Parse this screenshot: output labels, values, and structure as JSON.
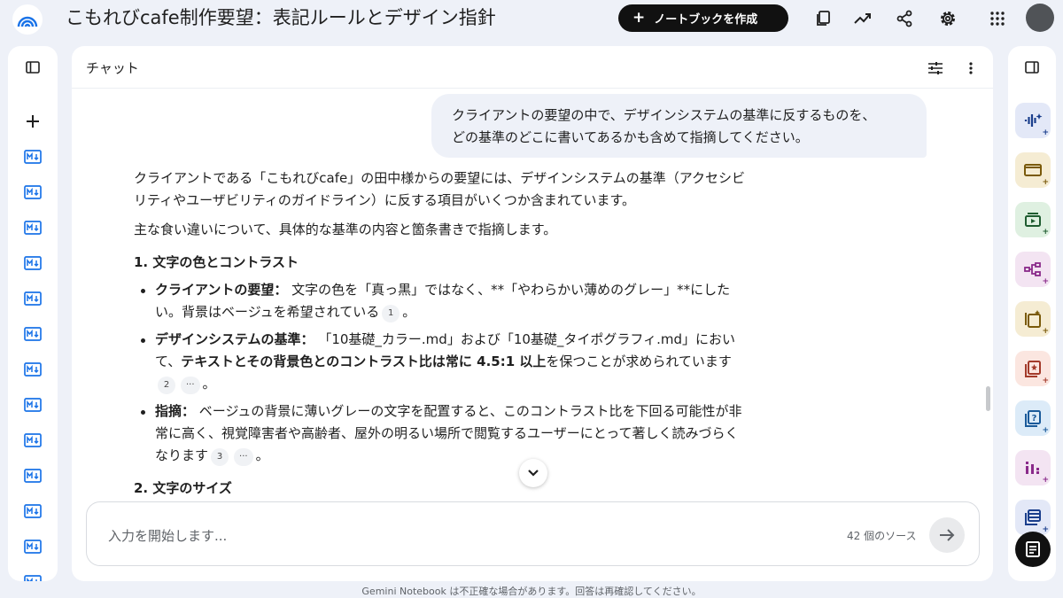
{
  "header": {
    "title": "こもれびcafe制作要望：表記ルールとデザイン指針",
    "create_label": "ノートブックを作成",
    "create_icon": "plus-icon",
    "icons": [
      "layers-icon",
      "trending-up-icon",
      "share-icon",
      "gear-icon",
      "apps-grid-icon"
    ]
  },
  "chat": {
    "title": "チャット",
    "user_message": {
      "line1": "クライアントの要望の中で、デザインシステムの基準に反するものを、",
      "line2": "どの基準のどこに書いてあるかも含めて指摘してください。"
    },
    "answer": {
      "intro1": "クライアントである「こもれびcafe」の田中様からの要望には、デザインシステムの基準（アクセシビリティやユーザビリティのガイドライン）に反する項目がいくつか含まれています。",
      "intro2": "主な食い違いについて、具体的な基準の内容と箇条書きで指摘します。",
      "section1_title": "1. 文字の色とコントラスト",
      "item1_label": "クライアントの要望：",
      "item1_text": " 文字の色を「真っ黒」ではなく、**「やわらかい薄めのグレー」**にしたい。背景はベージュを希望されている",
      "item1_cite": "1",
      "item1_end": "。",
      "item2_label": "デザインシステムの基準：",
      "item2_text_a": " 「10基礎_カラー.md」および「10基礎_タイポグラフィ.md」において、",
      "item2_bold": "テキストとその背景色とのコントラスト比は常に 4.5:1 以上",
      "item2_text_b": "を保つことが求められています",
      "item2_cite": "2",
      "item2_more": "···",
      "item2_end": "。",
      "item3_label": "指摘：",
      "item3_text": " ベージュの背景に薄いグレーの文字を配置すると、このコントラスト比を下回る可能性が非常に高く、視覚障害者や高齢者、屋外の明るい場所で閲覧するユーザーにとって著しく読みづらくなります",
      "item3_cite": "3",
      "item3_more": "···",
      "item3_end": "。",
      "section2_title": "2. 文字のサイズ"
    },
    "input_placeholder": "入力を開始します...",
    "source_count": "42 個のソース"
  },
  "footer": "Gemini Notebook は不正確な場合があります。回答は再確認してください。",
  "colors": {
    "background": "#eef1f8",
    "panel": "#ffffff",
    "accent_blue": "#1a73e8",
    "studio_audio": "#1a3e8c",
    "studio_slides": "#7a5a0a",
    "studio_video": "#1f5c30",
    "studio_mindmap": "#8a2a8a",
    "studio_report": "#7a5a0a",
    "studio_flashcards": "#a33a2a",
    "studio_quiz": "#1a5a9a",
    "studio_infographic": "#8a2a8a",
    "studio_table": "#1a3e8c"
  }
}
